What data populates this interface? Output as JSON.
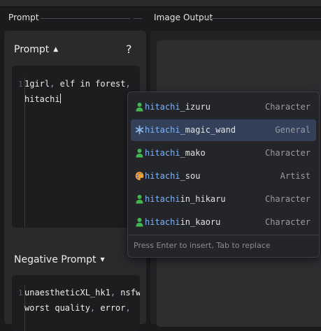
{
  "header": {
    "left_title": "Prompt",
    "right_title": "Image Output"
  },
  "prompt": {
    "label": "Prompt",
    "collapse_arrow": "▲",
    "help": "?",
    "line_number": "1"
  },
  "negative": {
    "label": "Negative Prompt",
    "collapse_arrow": "▼",
    "line_number": "1",
    "line1_a": "unaestheticXL_hk1",
    "line1_b": ",",
    "line1_c": " nsfw",
    "line1_d": ",",
    "line2_a": "worst quality",
    "line2_b": ",",
    "line2_c": " error",
    "line2_d": ","
  },
  "editor": {
    "line1_a": "1girl",
    "line1_b": ",",
    "line1_c": " elf in forest",
    "line1_d": ",",
    "line2_a": "hitachi"
  },
  "autocomplete": {
    "items": [
      {
        "match": "hitachi",
        "rest": "_izuru",
        "category": "Character",
        "icon": "person-icon"
      },
      {
        "match": "hitachi",
        "rest": "_magic_wand",
        "category": "General",
        "icon": "asterisk-icon"
      },
      {
        "match": "hitachi",
        "rest": "_mako",
        "category": "Character",
        "icon": "person-icon"
      },
      {
        "match": "hitachi",
        "rest": "_sou",
        "category": "Artist",
        "icon": "palette-icon"
      },
      {
        "match": "hitachi",
        "rest": "in_hikaru",
        "category": "Character",
        "icon": "person-icon"
      },
      {
        "match": "hitachi",
        "rest": "in_kaoru",
        "category": "Character",
        "icon": "person-icon"
      }
    ],
    "footer": "Press Enter to insert, Tab to replace"
  },
  "colors": {
    "character": "#3fb94f",
    "general": "#8fb8ea",
    "artist": "#e9a33a",
    "selected": "#33405a",
    "match": "#7fb3f5"
  }
}
